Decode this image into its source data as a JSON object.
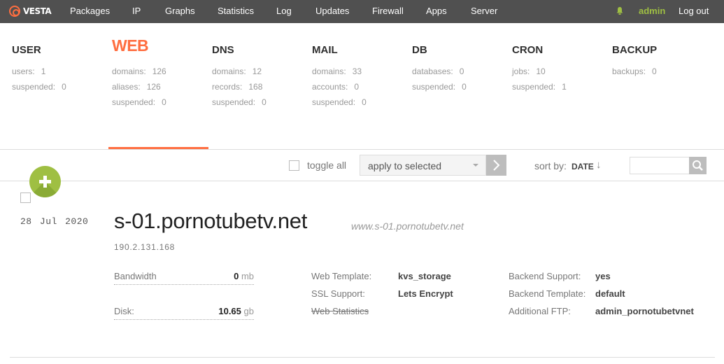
{
  "topbar": {
    "logo_text": "VESTA",
    "nav": [
      "Packages",
      "IP",
      "Graphs",
      "Statistics",
      "Log",
      "Updates",
      "Firewall",
      "Apps",
      "Server"
    ],
    "user": "admin",
    "logout": "Log out",
    "accent": "#ff6e40",
    "bar_color": "#505050"
  },
  "stats": [
    {
      "title": "USER",
      "rows": [
        {
          "label": "users:",
          "value": "1"
        },
        {
          "label": "suspended:",
          "value": "0"
        }
      ]
    },
    {
      "title": "WEB",
      "rows": [
        {
          "label": "domains:",
          "value": "126"
        },
        {
          "label": "aliases:",
          "value": "126"
        },
        {
          "label": "suspended:",
          "value": "0"
        }
      ]
    },
    {
      "title": "DNS",
      "rows": [
        {
          "label": "domains:",
          "value": "12"
        },
        {
          "label": "records:",
          "value": "168"
        },
        {
          "label": "suspended:",
          "value": "0"
        }
      ]
    },
    {
      "title": "MAIL",
      "rows": [
        {
          "label": "domains:",
          "value": "33"
        },
        {
          "label": "accounts:",
          "value": "0"
        },
        {
          "label": "suspended:",
          "value": "0"
        }
      ]
    },
    {
      "title": "DB",
      "rows": [
        {
          "label": "databases:",
          "value": "0"
        },
        {
          "label": "suspended:",
          "value": "0"
        }
      ]
    },
    {
      "title": "CRON",
      "rows": [
        {
          "label": "jobs:",
          "value": "10"
        },
        {
          "label": "suspended:",
          "value": "1"
        }
      ]
    },
    {
      "title": "BACKUP",
      "rows": [
        {
          "label": "backups:",
          "value": "0"
        }
      ]
    }
  ],
  "toolbar": {
    "toggle_all": "toggle all",
    "apply_selected": "apply to selected",
    "sort_by": "sort by:",
    "sort_value": "DATE",
    "sort_arrow": "↓",
    "search_placeholder": ""
  },
  "add_button": "+",
  "record": {
    "date": "28 Jul 2020",
    "domain": "s-01.pornotubetv.net",
    "alias": "www.s-01.pornotubetv.net",
    "ip": "190.2.131.168",
    "bandwidth_label": "Bandwidth",
    "bandwidth_value": "0",
    "bandwidth_unit": "mb",
    "disk_label": "Disk:",
    "disk_value": "10.65",
    "disk_unit": "gb",
    "web_template_label": "Web Template:",
    "web_template_value": "kvs_storage",
    "ssl_label": "SSL Support:",
    "ssl_value": "Lets Encrypt",
    "web_stats_label": "Web Statistics",
    "backend_support_label": "Backend Support:",
    "backend_support_value": "yes",
    "backend_template_label": "Backend Template:",
    "backend_template_value": "default",
    "ftp_label": "Additional FTP:",
    "ftp_value": "admin_pornotubetvnet"
  }
}
